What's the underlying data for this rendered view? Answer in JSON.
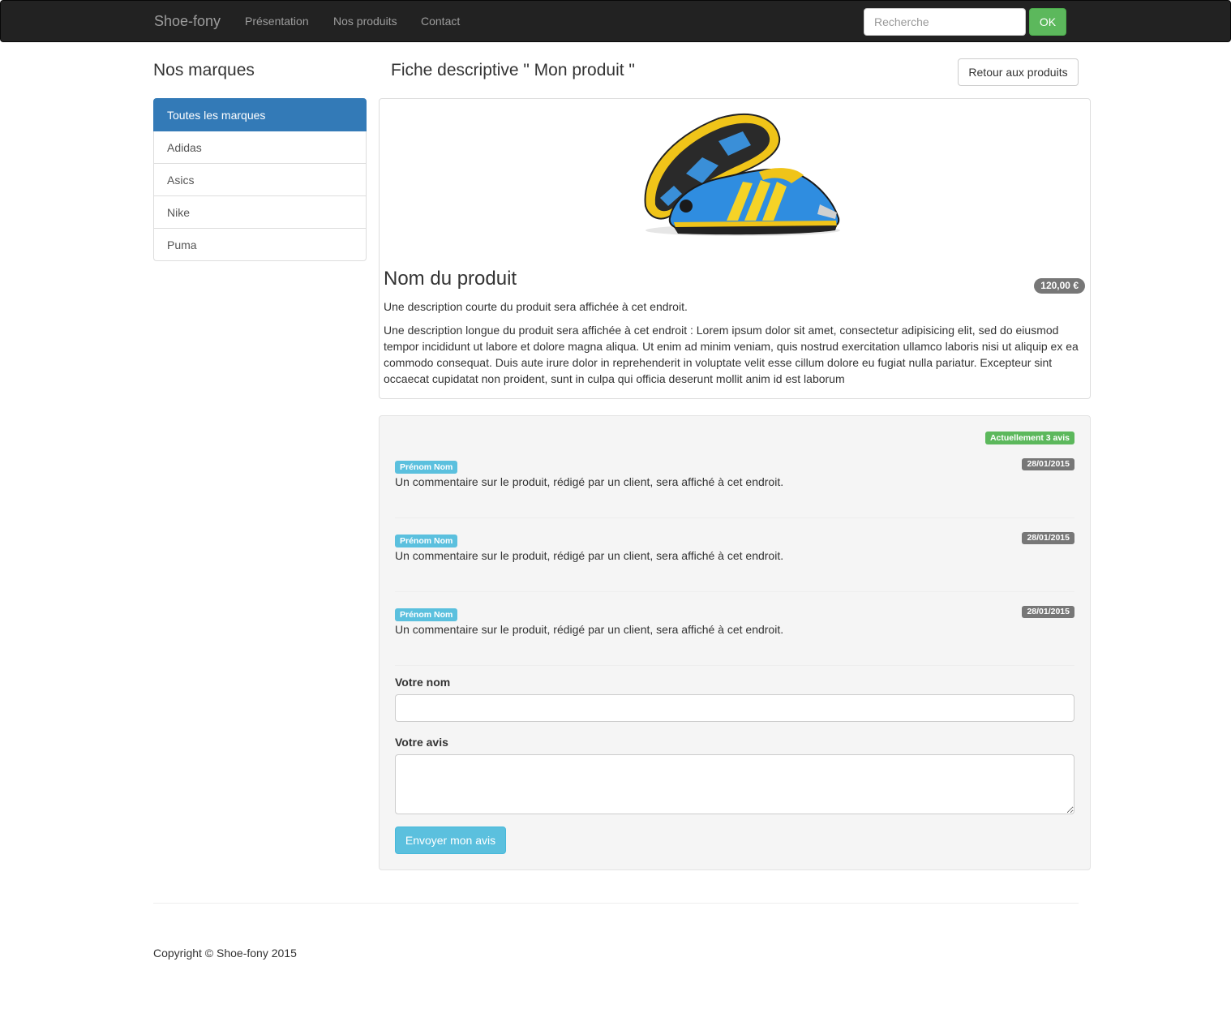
{
  "navbar": {
    "brand": "Shoe-fony",
    "links": [
      "Présentation",
      "Nos produits",
      "Contact"
    ],
    "search_placeholder": "Recherche",
    "search_button": "OK"
  },
  "sidebar": {
    "title": "Nos marques",
    "items": [
      {
        "label": "Toutes les marques",
        "active": true
      },
      {
        "label": "Adidas",
        "active": false
      },
      {
        "label": "Asics",
        "active": false
      },
      {
        "label": "Nike",
        "active": false
      },
      {
        "label": "Puma",
        "active": false
      }
    ]
  },
  "main": {
    "title": "Fiche descriptive \" Mon produit \"",
    "back_button": "Retour aux produits"
  },
  "product": {
    "name": "Nom du produit",
    "price": "120,00 €",
    "short_description": "Une description courte du produit sera affichée à cet endroit.",
    "long_description": "Une description longue du produit sera affichée à cet endroit : Lorem ipsum dolor sit amet, consectetur adipisicing elit, sed do eiusmod tempor incididunt ut labore et dolore magna aliqua. Ut enim ad minim veniam, quis nostrud exercitation ullamco laboris nisi ut aliquip ex ea commodo consequat. Duis aute irure dolor in reprehenderit in voluptate velit esse cillum dolore eu fugiat nulla pariatur. Excepteur sint occaecat cupidatat non proident, sunt in culpa qui officia deserunt mollit anim id est laborum"
  },
  "reviews": {
    "count_label": "Actuellement 3 avis",
    "items": [
      {
        "author": "Prénom Nom",
        "date": "28/01/2015",
        "text": "Un commentaire sur le produit, rédigé par un client, sera affiché à cet endroit."
      },
      {
        "author": "Prénom Nom",
        "date": "28/01/2015",
        "text": "Un commentaire sur le produit, rédigé par un client, sera affiché à cet endroit."
      },
      {
        "author": "Prénom Nom",
        "date": "28/01/2015",
        "text": "Un commentaire sur le produit, rédigé par un client, sera affiché à cet endroit."
      }
    ],
    "form": {
      "name_label": "Votre nom",
      "review_label": "Votre avis",
      "name_value": "",
      "review_value": "",
      "submit_label": "Envoyer mon avis"
    }
  },
  "footer": {
    "copyright": "Copyright © Shoe-fony 2015"
  },
  "colors": {
    "navbar_bg": "#222222",
    "primary": "#337ab7",
    "success": "#5cb85c",
    "info": "#5bc0de",
    "default_label": "#777777"
  }
}
